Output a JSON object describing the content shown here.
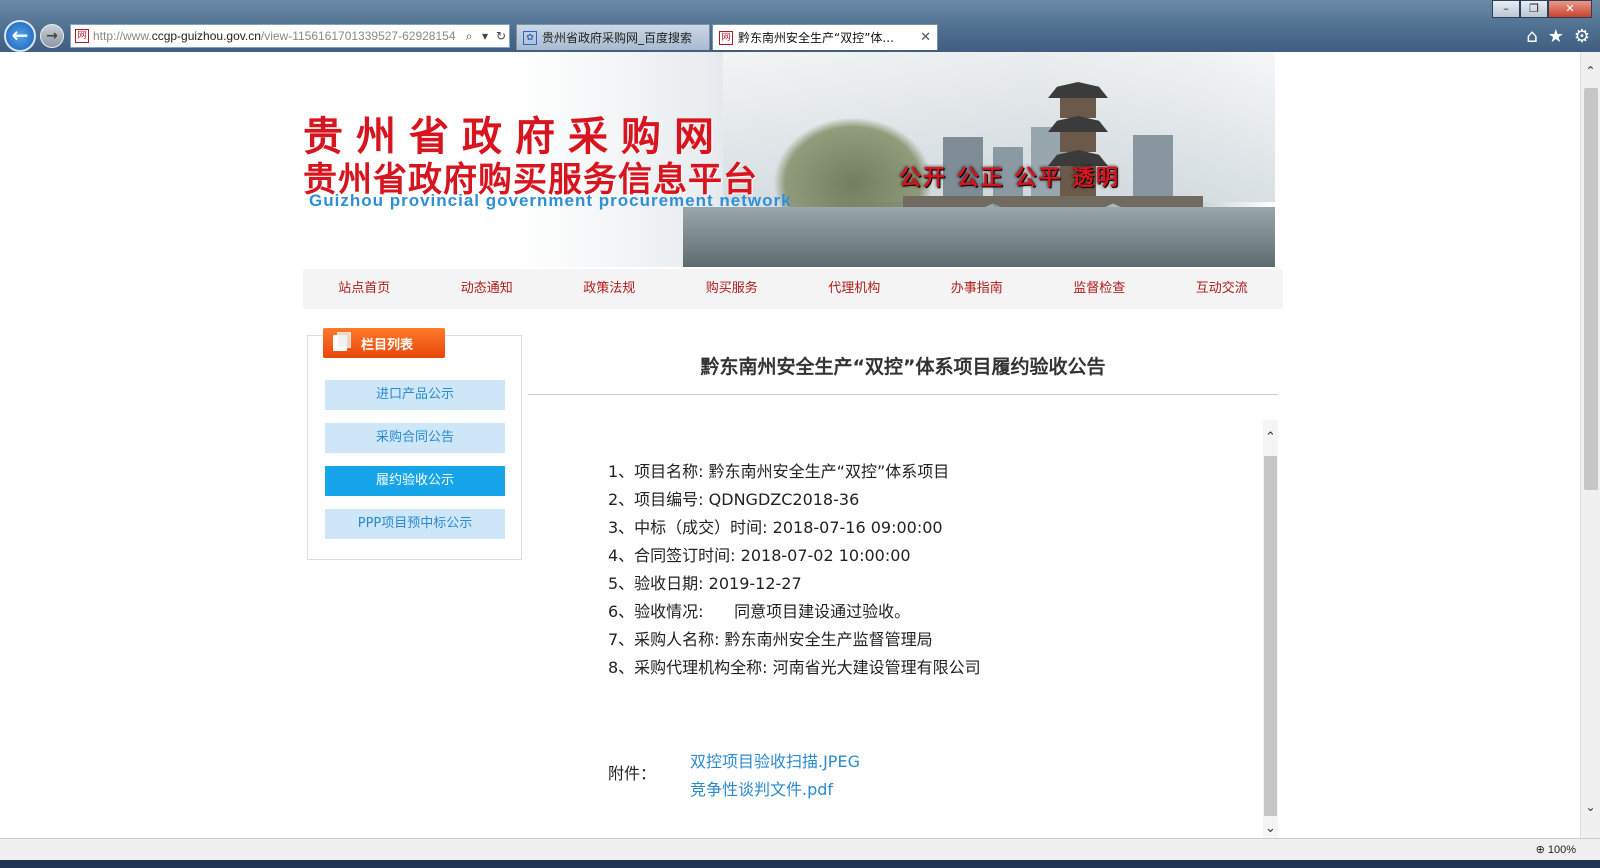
{
  "browser": {
    "url_prefix": "http://www.",
    "url_domain": "ccgp-guizhou.gov.cn",
    "url_rest": "/view-1156161701339527-62928154",
    "tabs": [
      {
        "label": "贵州省政府采购网_百度搜索"
      },
      {
        "label": "黔东南州安全生产“双控”体..."
      }
    ],
    "zoom": "100%",
    "favicon_char": "网"
  },
  "banner": {
    "title_line1": "贵州省政府采购网",
    "title_line2": "贵州省政府购买服务信息平台",
    "title_en": "Guizhou provincial government procurement network",
    "slogan": "公开 公正 公平 透明"
  },
  "nav": {
    "items": [
      "站点首页",
      "动态通知",
      "政策法规",
      "购买服务",
      "代理机构",
      "办事指南",
      "监督检查",
      "互动交流"
    ]
  },
  "sidebar": {
    "heading": "栏目列表",
    "items": [
      {
        "label": "进口产品公示"
      },
      {
        "label": "采购合同公告"
      },
      {
        "label": "履约验收公示"
      },
      {
        "label": "PPP项目预中标公示"
      }
    ]
  },
  "article": {
    "title": "黔东南州安全生产“双控”体系项目履约验收公告",
    "lines": [
      "1、项目名称: 黔东南州安全生产“双控”体系项目",
      "2、项目编号: QDNGDZC2018-36",
      "3、中标（成交）时间: 2018-07-16 09:00:00",
      "4、合同签订时间: 2018-07-02 10:00:00",
      "5、验收日期: 2019-12-27",
      "6、验收情况:      同意项目建设通过验收。",
      "7、采购人名称: 黔东南州安全生产监督管理局",
      "8、采购代理机构全称: 河南省光大建设管理有限公司"
    ],
    "attachments_label": "附件：",
    "attachments": [
      "双控项目验收扫描.JPEG",
      "竞争性谈判文件.pdf"
    ]
  }
}
